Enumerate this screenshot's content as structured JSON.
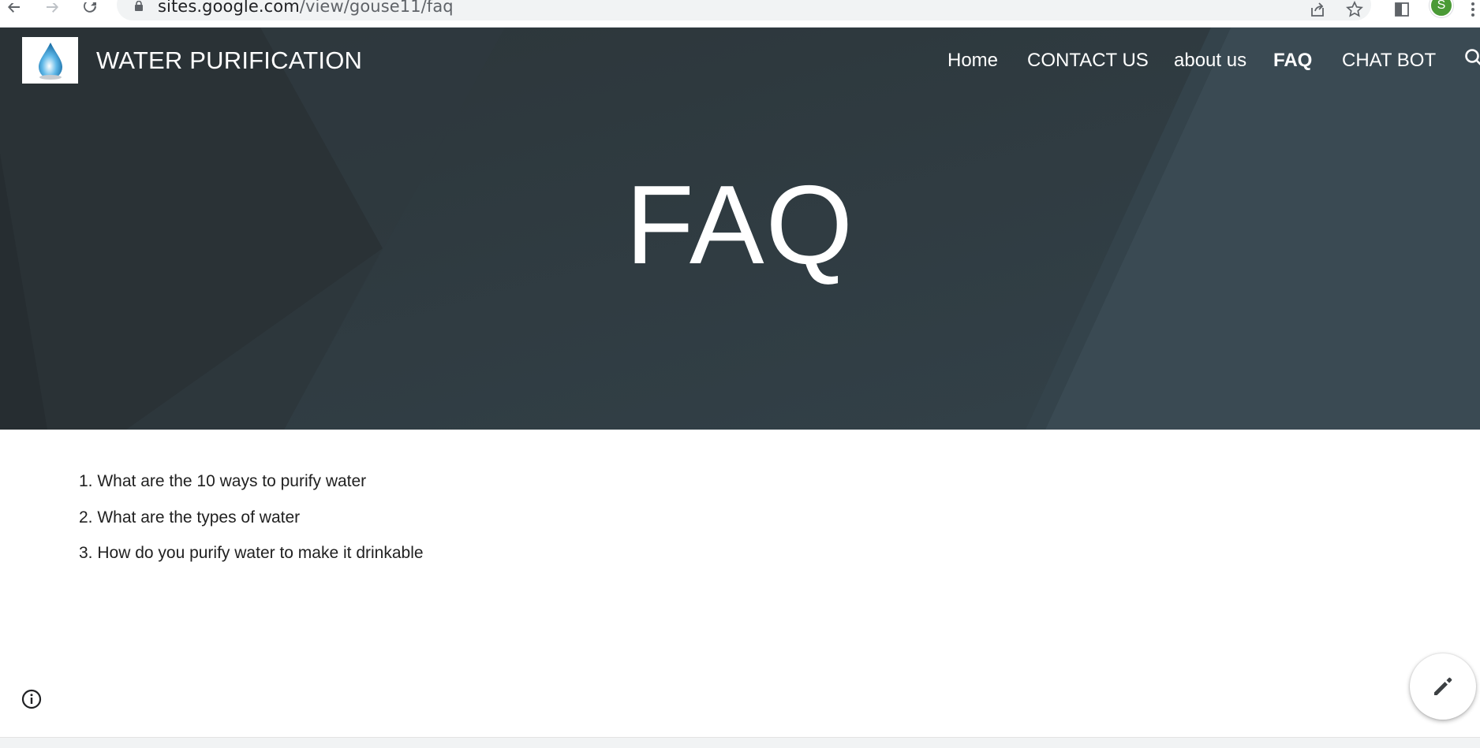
{
  "browser": {
    "url_host": "sites.google.com",
    "url_path": "/view/gouse11/faq",
    "profile_initial": "S",
    "profile_color": "#4a9a36"
  },
  "site": {
    "title": "WATER PURIFICATION",
    "logo_icon": "water-drop-logo",
    "nav": [
      {
        "label": "Home",
        "active": false
      },
      {
        "label": "CONTACT US",
        "active": false
      },
      {
        "label": "about us",
        "active": false
      },
      {
        "label": "FAQ",
        "active": true
      },
      {
        "label": "CHAT BOT",
        "active": false
      }
    ],
    "hero_bg_color": "#323d44"
  },
  "page": {
    "heading": "FAQ",
    "questions": [
      "1. What are the 10 ways to purify water",
      "2. What are the types of water",
      "3. How do you purify water to make it drinkable"
    ]
  },
  "icons": {
    "info": "info-icon",
    "edit": "pencil-icon",
    "search": "search-icon"
  }
}
